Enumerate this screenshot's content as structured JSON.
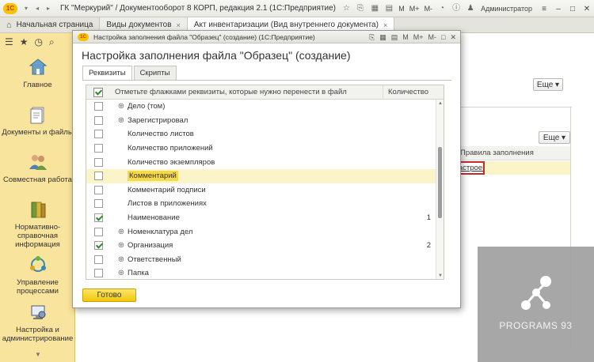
{
  "app": {
    "logo_text": "1С",
    "title": "ГК \"Меркурий\" / Документооборот 8 КОРП, редакция 2.1  (1С:Предприятие)",
    "m_label": "M",
    "m_plus": "M+",
    "m_minus": "M-",
    "user": "Администратор"
  },
  "tabs": [
    {
      "label": "Начальная страница"
    },
    {
      "label": "Виды документов"
    },
    {
      "label": "Акт инвентаризации (Вид внутреннего документа)"
    }
  ],
  "sidebar": {
    "items": [
      {
        "label": "Главное",
        "icon": "home-icon"
      },
      {
        "label": "Документы и файлы",
        "icon": "documents-icon"
      },
      {
        "label": "Совместная работа",
        "icon": "users-icon"
      },
      {
        "label": "Нормативно-справочная информация",
        "icon": "books-icon"
      },
      {
        "label": "Управление процессами",
        "icon": "process-icon"
      },
      {
        "label": "Настройка и администрирование",
        "icon": "settings-icon"
      }
    ]
  },
  "background": {
    "more_button_1": "Еще ▾",
    "more_button_2": "Еще ▾",
    "column_header": "Правила заполнения",
    "highlighted_cell": "Настроено"
  },
  "dialog": {
    "logo_text": "1С",
    "window_title": "Настройка заполнения файла \"Образец\" (создание)  (1С:Предприятие)",
    "heading": "Настройка заполнения файла \"Образец\" (создание)",
    "tabs": [
      {
        "label": "Реквизиты"
      },
      {
        "label": "Скрипты"
      }
    ],
    "grid": {
      "header_label": "Отметьте флажками реквизиты, которые нужно перенести в файл",
      "header_qty": "Количество",
      "rows": [
        {
          "label": "Дело (том)",
          "checked": false,
          "expandable": true,
          "qty": ""
        },
        {
          "label": "Зарегистрировал",
          "checked": false,
          "expandable": true,
          "qty": ""
        },
        {
          "label": "Количество листов",
          "checked": false,
          "expandable": false,
          "qty": ""
        },
        {
          "label": "Количество приложений",
          "checked": false,
          "expandable": false,
          "qty": ""
        },
        {
          "label": "Количество экземпляров",
          "checked": false,
          "expandable": false,
          "qty": ""
        },
        {
          "label": "Комментарий",
          "checked": false,
          "expandable": false,
          "qty": "",
          "selected": true
        },
        {
          "label": "Комментарий подписи",
          "checked": false,
          "expandable": false,
          "qty": ""
        },
        {
          "label": "Листов в приложениях",
          "checked": false,
          "expandable": false,
          "qty": ""
        },
        {
          "label": "Наименование",
          "checked": true,
          "expandable": false,
          "qty": "1"
        },
        {
          "label": "Номенклатура дел",
          "checked": false,
          "expandable": true,
          "qty": ""
        },
        {
          "label": "Организация",
          "checked": true,
          "expandable": true,
          "qty": "2"
        },
        {
          "label": "Ответственный",
          "checked": false,
          "expandable": true,
          "qty": ""
        },
        {
          "label": "Папка",
          "checked": false,
          "expandable": true,
          "qty": ""
        }
      ]
    },
    "ok_button": "Готово",
    "mt_m": "M",
    "mt_mplus": "M+",
    "mt_mminus": "M-"
  },
  "watermark": {
    "text": "PROGRAMS 93"
  }
}
